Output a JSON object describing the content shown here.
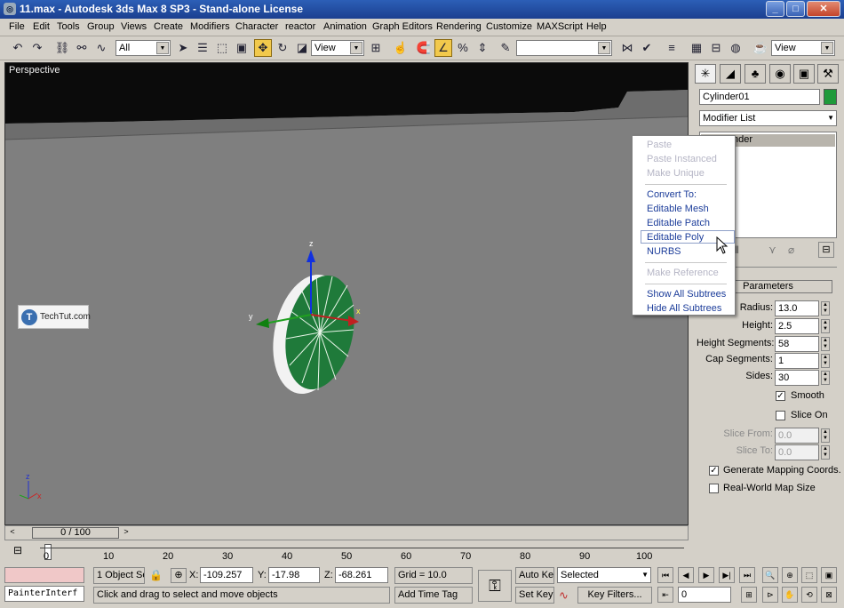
{
  "window": {
    "title": "11.max - Autodesk 3ds Max 8 SP3  - Stand-alone License",
    "minimize": "_",
    "maximize": "□",
    "close": "✕"
  },
  "menu": [
    "File",
    "Edit",
    "Tools",
    "Group",
    "Views",
    "Create",
    "Modifiers",
    "Character",
    "reactor",
    "Animation",
    "Graph Editors",
    "Rendering",
    "Customize",
    "MAXScript",
    "Help"
  ],
  "toolbar": {
    "selection_filter": "All",
    "ref_coord": "View",
    "named_selection": "",
    "render_view": "View"
  },
  "viewport": {
    "label": "Perspective",
    "watermark": "TechTut.com",
    "gizmo_x": "x",
    "gizmo_y": "y",
    "gizmo_z": "z",
    "axis_x": "x",
    "axis_z": "z"
  },
  "context_menu": {
    "items": [
      "Paste",
      "Paste Instanced",
      "Make Unique",
      "Convert To:",
      "Editable Mesh",
      "Editable Patch",
      "Editable Poly",
      "NURBS",
      "Make Reference",
      "Show All Subtrees",
      "Hide All Subtrees"
    ]
  },
  "command_panel": {
    "object_name": "Cylinder01",
    "object_color": "#1f9a3a",
    "modifier_list": "Modifier List",
    "stack_item": "nder",
    "rollout_title": "Parameters",
    "params": {
      "radius_label": "Radius:",
      "radius": "13.0",
      "height_label": "Height:",
      "height": "2.5",
      "height_segments_label": "Height Segments:",
      "height_segments": "58",
      "cap_segments_label": "Cap Segments:",
      "cap_segments": "1",
      "sides_label": "Sides:",
      "sides": "30",
      "smooth_label": "Smooth",
      "slice_on_label": "Slice On",
      "slice_from_label": "Slice From:",
      "slice_from": "0.0",
      "slice_to_label": "Slice To:",
      "slice_to": "0.0",
      "gen_mapping_label": "Generate Mapping Coords.",
      "real_world_label": "Real-World Map Size"
    }
  },
  "timeline": {
    "frame_display": "0 / 100",
    "ticks": [
      "0",
      "10",
      "20",
      "30",
      "40",
      "50",
      "60",
      "70",
      "80",
      "90",
      "100"
    ]
  },
  "status": {
    "maxscript_listener": "PainterInterf",
    "selection_count": "1 Object Se",
    "x_label": "X:",
    "x": "-109.257",
    "y_label": "Y:",
    "y": "-17.98",
    "z_label": "Z:",
    "z": "-68.261",
    "grid": "Grid = 10.0",
    "prompt": "Click and drag to select and move objects",
    "add_time_tag": "Add Time Tag",
    "auto_key": "Auto Key",
    "set_key": "Set Key",
    "key_mode": "Selected",
    "key_filters": "Key Filters...",
    "current_frame": "0"
  }
}
